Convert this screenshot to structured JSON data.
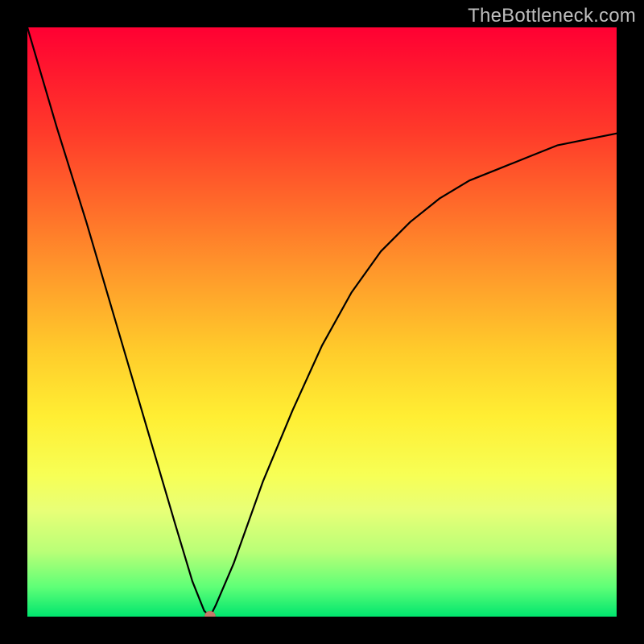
{
  "watermark": "TheBottleneck.com",
  "chart_data": {
    "type": "line",
    "title": "",
    "xlabel": "",
    "ylabel": "",
    "xlim": [
      0,
      100
    ],
    "ylim": [
      0,
      100
    ],
    "grid": false,
    "legend": false,
    "series": [
      {
        "name": "bottleneck-curve",
        "x": [
          0,
          5,
          10,
          15,
          20,
          25,
          28,
          30,
          31,
          32,
          35,
          40,
          45,
          50,
          55,
          60,
          65,
          70,
          75,
          80,
          85,
          90,
          95,
          100
        ],
        "values": [
          100,
          83,
          67,
          50,
          33,
          16,
          6,
          1,
          0,
          2,
          9,
          23,
          35,
          46,
          55,
          62,
          67,
          71,
          74,
          76,
          78,
          80,
          81,
          82
        ]
      }
    ],
    "annotations": [
      {
        "name": "min-point",
        "x": 31,
        "y": 0
      }
    ],
    "background_gradient": {
      "top": "#ff0033",
      "bottom": "#00e56e"
    }
  }
}
